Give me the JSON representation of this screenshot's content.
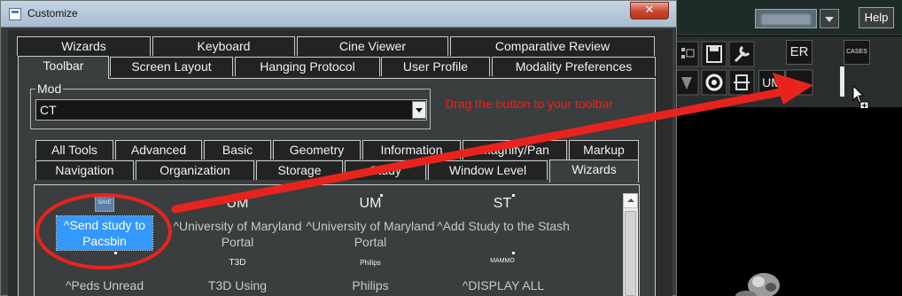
{
  "background_app": {
    "help_label": "Help",
    "toolbar_buttons": {
      "er": "ER",
      "um": "UM",
      "cases": "CASES"
    }
  },
  "dialog": {
    "title": "Customize",
    "close_glyph": "✕",
    "tab_rows": [
      [
        "Wizards",
        "Keyboard",
        "Cine Viewer",
        "Comparative Review"
      ],
      [
        "Toolbar",
        "Screen Layout",
        "Hanging Protocol",
        "User Profile",
        "Modality Preferences"
      ]
    ],
    "active_tab": "Toolbar",
    "mod": {
      "label": "Mod",
      "value": "CT"
    },
    "category_rows": [
      [
        "All Tools",
        "Advanced",
        "Basic",
        "Geometry",
        "Information",
        "Magnify/Pan",
        "Markup"
      ],
      [
        "Navigation",
        "Organization",
        "Storage",
        "Study",
        "Window Level",
        "Wizards"
      ]
    ],
    "active_category": "Wizards",
    "tools": [
      {
        "icon_text": "SAVE",
        "label": "^Send study to Pacsbin",
        "selected": true
      },
      {
        "icon_text": "UM",
        "label": "^University of Maryland Portal",
        "selected": false
      },
      {
        "icon_text": "UM",
        "label": "^University of Maryland Portal",
        "selected": false
      },
      {
        "icon_text": "ST",
        "label": "^Add Study to the Stash",
        "selected": false
      }
    ],
    "tools_row2": [
      {
        "icon_text": "",
        "label": "^Peds Unread"
      },
      {
        "icon_text": "T3D",
        "label": "T3D Using"
      },
      {
        "icon_text": "Philips",
        "label": "Philips"
      },
      {
        "icon_text": "MAMMO",
        "label": "^DISPLAY ALL"
      }
    ]
  },
  "annotation": {
    "text": "Drag the button to your toolbar",
    "color": "#e8231e"
  },
  "colors": {
    "dialog_bg": "#3b3e3e",
    "selection": "#3399ff",
    "title_bar": "#b4c7d9",
    "close_button": "#c8452d"
  }
}
